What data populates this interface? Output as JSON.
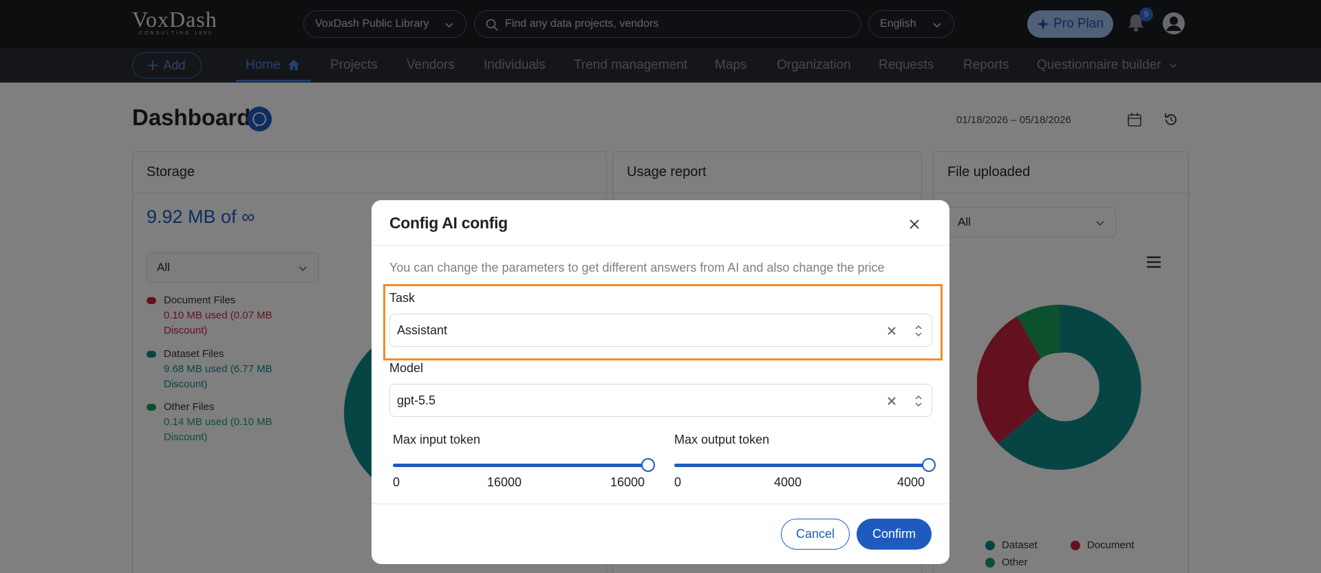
{
  "topbar": {
    "logo_text": "VoxDash",
    "logo_subtext": "CONSULTING 1896",
    "library_select": "VoxDash Public Library",
    "search_placeholder": "Find any data projects, vendors",
    "language_select": "English",
    "pro_plan_label": "Pro Plan",
    "notification_count": "5"
  },
  "nav": {
    "add_label": "Add",
    "items": [
      "Home",
      "Projects",
      "Vendors",
      "Individuals",
      "Trend management",
      "Maps",
      "Organization",
      "Requests",
      "Reports",
      "Questionnaire builder"
    ],
    "active": "Home"
  },
  "dashboard": {
    "title": "Dashboard",
    "date_range": "01/18/2026 – 05/18/2026",
    "storage": {
      "title": "Storage",
      "total": "9.92 MB of ∞",
      "filter": "All",
      "legend": [
        {
          "name": "Document Files",
          "detail": "0.10 MB used (0.07 MB Discount)",
          "color": "#c8233f"
        },
        {
          "name": "Dataset Files",
          "detail": "9.68 MB used (6.77 MB Discount)",
          "color": "#0f8a8a"
        },
        {
          "name": "Other Files",
          "detail": "0.14 MB used (0.10 MB Discount)",
          "color": "#18a35a"
        }
      ]
    },
    "usage_report": {
      "title": "Usage report"
    },
    "file_uploaded": {
      "title": "File uploaded",
      "filter": "All",
      "legend": [
        {
          "name": "Dataset",
          "color": "#0f6a6a"
        },
        {
          "name": "Document",
          "color": "#8c1d2e"
        },
        {
          "name": "Other",
          "color": "#137a45"
        }
      ]
    }
  },
  "modal": {
    "title": "Config AI config",
    "description": "You can change the parameters to get different answers from AI and also change the price",
    "task_label": "Task",
    "task_value": "Assistant",
    "model_label": "Model",
    "model_value": "gpt-5.5",
    "max_input": {
      "label": "Max input token",
      "min": "0",
      "current": "16000",
      "max": "16000",
      "fraction": 1.0
    },
    "max_output": {
      "label": "Max output token",
      "min": "0",
      "current": "4000",
      "max": "4000",
      "fraction": 1.0
    },
    "cancel_label": "Cancel",
    "confirm_label": "Confirm",
    "highlight_color": "#f58a2c",
    "accent_color": "#1f5bbf"
  }
}
